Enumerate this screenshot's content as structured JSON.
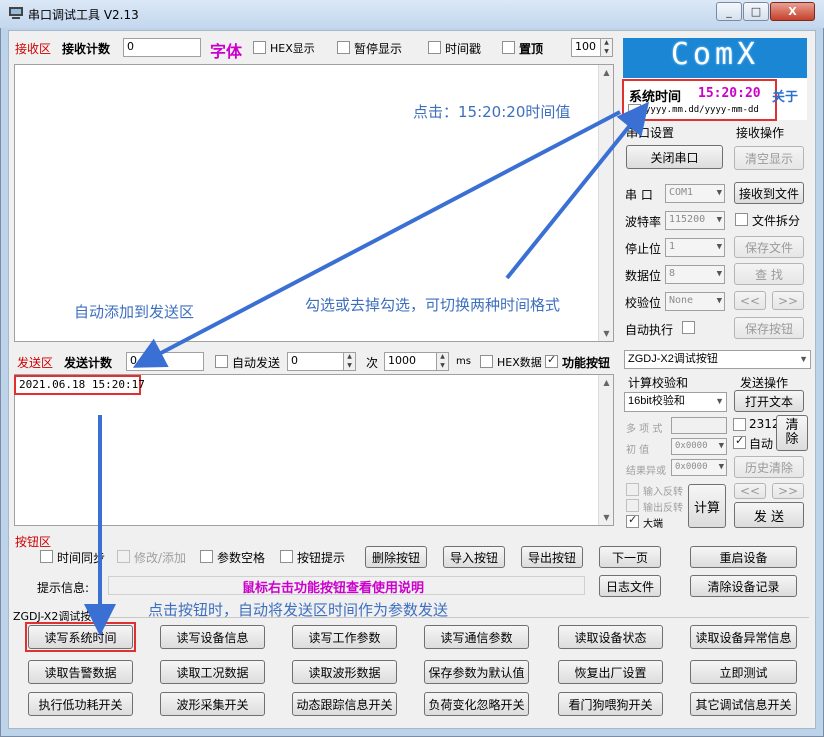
{
  "window": {
    "title": "串口调试工具  V2.13",
    "min_label": "_",
    "max_label": "□",
    "close_label": "X"
  },
  "receive": {
    "area_label": "接收区",
    "count_label": "接收计数",
    "count_value": "0",
    "font_label": "字体",
    "hex_label": "HEX显示",
    "pause_label": "暂停显示",
    "timestamp_label": "时间戳",
    "top_label": "置顶",
    "top_value": "100"
  },
  "logo": {
    "text": "ComX",
    "systime_label": "系统时间",
    "systime_value": "15:20:20",
    "about_label": "关于",
    "time_format": "yyyy.mm.dd/yyyy-mm-dd"
  },
  "serial": {
    "group_label": "串口设置",
    "close_port_button": "关闭串口",
    "port_label": "串  口",
    "port_value": "COM1",
    "baud_label": "波特率",
    "baud_value": "115200",
    "stop_label": "停止位",
    "stop_value": "1",
    "data_label": "数据位",
    "data_value": "8",
    "parity_label": "校验位",
    "parity_value": "None",
    "auto_exec_label": "自动执行"
  },
  "recv_ops": {
    "group_label": "接收操作",
    "clear_button": "清空显示",
    "recv_file_button": "接收到文件",
    "split_label": "文件拆分",
    "save_file_button": "保存文件",
    "find_button": "查  找",
    "prev_button": "<<",
    "next_button": ">>",
    "save_btn_button": "保存按钮"
  },
  "send": {
    "area_label": "发送区",
    "count_label": "发送计数",
    "count_value": "0",
    "auto_send_label": "自动发送",
    "auto_value": "0",
    "times_label": "次",
    "interval_value": "1000",
    "ms_label": "ms",
    "hex_label": "HEX数据",
    "func_label": "功能按钮",
    "text": "2021.06.18 15:20:17"
  },
  "right_send": {
    "dropdown_value": "ZGDJ-X2调试按钮",
    "checksum_label": "计算校验和",
    "checksum_value": "16bit校验和",
    "poly_label": "多 项 式",
    "init_label": "初    值",
    "init_value": "0x0000",
    "xor_label": "结果异或",
    "xor_value": "0x0000",
    "in_rev_label": "输入反转",
    "out_rev_label": "输出反转",
    "big_endian_label": "大端",
    "calc_button": "计算",
    "send_ops_label": "发送操作",
    "open_text_button": "打开文本",
    "v2312_label": "2312",
    "auto_label": "自动",
    "clear_button": "清除",
    "history_clear_button": "历史清除",
    "prev_button": "<<",
    "next_button": ">>",
    "send_button": "发  送"
  },
  "button_area": {
    "label": "按钮区",
    "time_sync_label": "时间同步",
    "modify_add_label": "修改/添加",
    "param_space_label": "参数空格",
    "btn_hint_label": "按钮提示",
    "delete_button": "删除按钮",
    "import_button": "导入按钮",
    "export_button": "导出按钮",
    "next_page_button": "下一页",
    "restart_button": "重启设备",
    "hint_label": "提示信息:",
    "hint_text": "鼠标右击功能按钮查看使用说明",
    "log_button": "日志文件",
    "clear_record_button": "清除设备记录",
    "group_label": "ZGDJ-X2调试按钮",
    "buttons": [
      "读写系统时间",
      "读写设备信息",
      "读写工作参数",
      "读写通信参数",
      "读取设备状态",
      "读取设备异常信息",
      "读取告警数据",
      "读取工况数据",
      "读取波形数据",
      "保存参数为默认值",
      "恢复出厂设置",
      "立即测试",
      "执行低功耗开关",
      "波形采集开关",
      "动态跟踪信息开关",
      "负荷变化忽略开关",
      "看门狗喂狗开关",
      "其它调试信息开关"
    ]
  },
  "annotations": {
    "click_time": "点击：15:20:20时间值",
    "toggle_format": "勾选或去掉勾选，可切换两种时间格式",
    "auto_add": "自动添加到发送区",
    "click_button": "点击按钮时，自动将发送区时间作为参数发送"
  }
}
